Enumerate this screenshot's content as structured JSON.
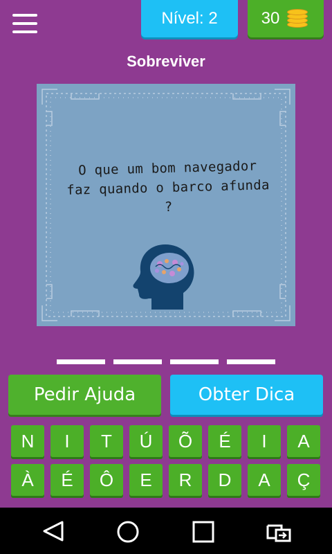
{
  "header": {
    "level_label": "Nível: 2",
    "coins": "30",
    "icons": {
      "menu": "hamburger-menu-icon",
      "coins": "coin-stack-icon"
    }
  },
  "title": "Sobreviver",
  "puzzle": {
    "question_line1": "O que um bom navegador",
    "question_line2": "faz quando o barco afunda ?",
    "image_icon": "head-brain-icon"
  },
  "answer": {
    "slots": 4
  },
  "buttons": {
    "help": "Pedir Ajuda",
    "hint": "Obter Dica"
  },
  "keyboard": {
    "row1": [
      "N",
      "I",
      "T",
      "Ú",
      "Õ",
      "É",
      "I",
      "A"
    ],
    "row2": [
      "À",
      "É",
      "Ô",
      "E",
      "R",
      "D",
      "A",
      "Ç"
    ]
  },
  "navbar": {
    "icons": [
      "back-triangle-icon",
      "home-circle-icon",
      "recents-square-icon",
      "screen-switch-icon"
    ]
  },
  "colors": {
    "background": "#8e3a91",
    "blue_accent": "#1ec0f5",
    "green_accent": "#4caf28",
    "card": "#7da3c4"
  }
}
